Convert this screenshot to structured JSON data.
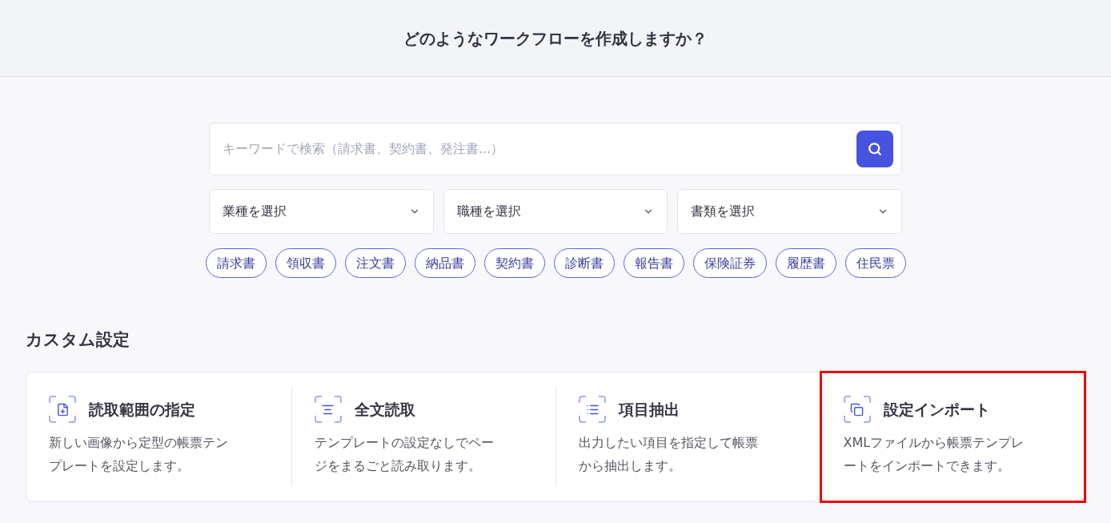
{
  "header": {
    "title": "どのようなワークフローを作成しますか？"
  },
  "search": {
    "placeholder": "キーワードで検索（請求書、契約書、発注書...）"
  },
  "filters": [
    {
      "label": "業種を選択"
    },
    {
      "label": "職種を選択"
    },
    {
      "label": "書類を選択"
    }
  ],
  "tags": [
    "請求書",
    "領収書",
    "注文書",
    "納品書",
    "契約書",
    "診断書",
    "報告書",
    "保険証券",
    "履歴書",
    "住民票"
  ],
  "custom_settings": {
    "title": "カスタム設定",
    "cards": [
      {
        "kind": "area",
        "title": "読取範囲の指定",
        "description": "新しい画像から定型の帳票テンプレートを設定します。",
        "highlighted": false
      },
      {
        "kind": "fulltext",
        "title": "全文読取",
        "description": "テンプレートの設定なしでページをまるごと読み取ります。",
        "highlighted": false
      },
      {
        "kind": "items",
        "title": "項目抽出",
        "description": "出力したい項目を指定して帳票から抽出します。",
        "highlighted": false
      },
      {
        "kind": "import",
        "title": "設定インポート",
        "description": "XMLファイルから帳票テンプレートをインポートできます。",
        "highlighted": true
      }
    ]
  }
}
